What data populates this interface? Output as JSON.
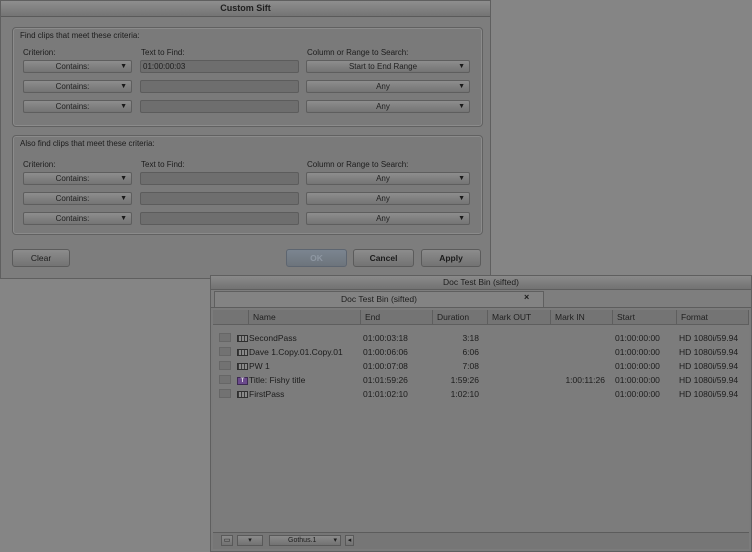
{
  "sift": {
    "title": "Custom Sift",
    "group1": {
      "title": "Find clips that meet these criteria:",
      "criterion_label": "Criterion:",
      "text_label": "Text to Find:",
      "range_label": "Column or Range to Search:",
      "rows": [
        {
          "criterion": "Contains:",
          "text": "01:00:00:03",
          "range": "Start to End Range"
        },
        {
          "criterion": "Contains:",
          "text": "",
          "range": "Any"
        },
        {
          "criterion": "Contains:",
          "text": "",
          "range": "Any"
        }
      ]
    },
    "group2": {
      "title": "Also find clips that meet these criteria:",
      "criterion_label": "Criterion:",
      "text_label": "Text to Find:",
      "range_label": "Column or Range to Search:",
      "rows": [
        {
          "criterion": "Contains:",
          "text": "",
          "range": "Any"
        },
        {
          "criterion": "Contains:",
          "text": "",
          "range": "Any"
        },
        {
          "criterion": "Contains:",
          "text": "",
          "range": "Any"
        }
      ]
    },
    "buttons": {
      "clear": "Clear",
      "ok": "OK",
      "cancel": "Cancel",
      "apply": "Apply"
    }
  },
  "bin": {
    "title": "Doc Test Bin (sifted)",
    "tab": "Doc Test Bin (sifted)",
    "tab_close": "×",
    "columns": [
      "Name",
      "End",
      "Duration",
      "Mark OUT",
      "Mark IN",
      "Start",
      "Format"
    ],
    "rows": [
      {
        "icon": "clip-icon",
        "name": "SecondPass",
        "end": "01:00:03:18",
        "duration": "3:18",
        "mark_out": "",
        "mark_in": "",
        "start": "01:00:00:00",
        "format": "HD 1080i/59.94"
      },
      {
        "icon": "clip-icon",
        "name": "Dave 1.Copy.01.Copy.01",
        "end": "01:00:06:06",
        "duration": "6:06",
        "mark_out": "",
        "mark_in": "",
        "start": "01:00:00:00",
        "format": "HD 1080i/59.94"
      },
      {
        "icon": "clip-icon",
        "name": "PW 1",
        "end": "01:00:07:08",
        "duration": "7:08",
        "mark_out": "",
        "mark_in": "",
        "start": "01:00:00:00",
        "format": "HD 1080i/59.94"
      },
      {
        "icon": "title-icon",
        "name": "Title: Fishy title",
        "end": "01:01:59:26",
        "duration": "1:59:26",
        "mark_out": "",
        "mark_in": "1:00:11:26",
        "start": "01:00:00:00",
        "format": "HD 1080i/59.94"
      },
      {
        "icon": "clip-icon",
        "name": "FirstPass",
        "end": "01:01:02:10",
        "duration": "1:02:10",
        "mark_out": "",
        "mark_in": "",
        "start": "01:00:00:00",
        "format": "HD 1080i/59.94"
      }
    ],
    "footer": {
      "view_menu": "Gothus.1"
    }
  }
}
